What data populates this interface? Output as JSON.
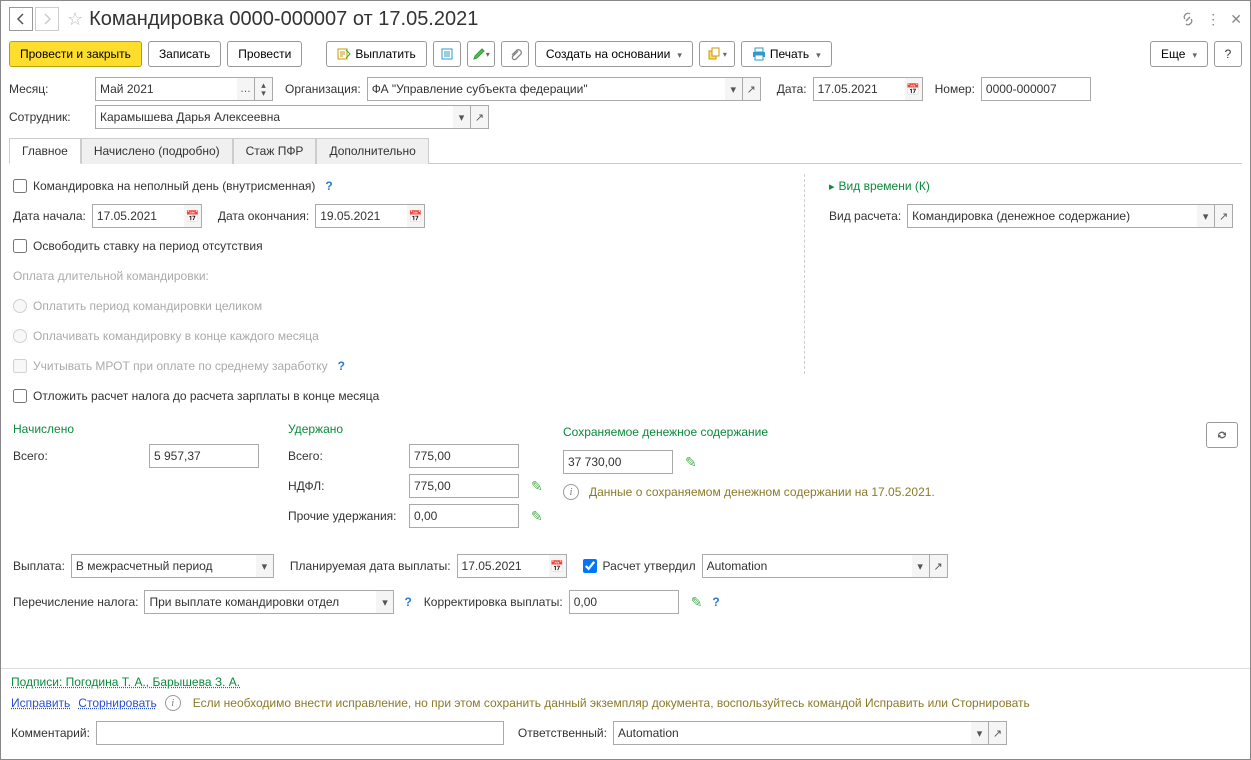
{
  "title": "Командировка 0000-000007 от 17.05.2021",
  "toolbar": {
    "post_close": "Провести и закрыть",
    "save": "Записать",
    "post": "Провести",
    "pay": "Выплатить",
    "create_based": "Создать на основании",
    "print": "Печать",
    "more": "Еще"
  },
  "header": {
    "month_label": "Месяц:",
    "month": "Май 2021",
    "org_label": "Организация:",
    "org": "ФА \"Управление субъекта федерации\"",
    "date_label": "Дата:",
    "date": "17.05.2021",
    "number_label": "Номер:",
    "number": "0000-000007",
    "employee_label": "Сотрудник:",
    "employee": "Карамышева Дарья Алексеевна"
  },
  "tabs": [
    "Главное",
    "Начислено (подробно)",
    "Стаж ПФР",
    "Дополнительно"
  ],
  "main": {
    "partial_day": "Командировка на неполный день (внутрисменная)",
    "start_label": "Дата начала:",
    "start": "17.05.2021",
    "end_label": "Дата окончания:",
    "end": "19.05.2021",
    "release_rate": "Освободить ставку на период отсутствия",
    "long_trip_label": "Оплата длительной командировки:",
    "pay_whole": "Оплатить период командировки целиком",
    "pay_monthly": "Оплачивать командировку в конце каждого месяца",
    "mrot": "Учитывать МРОТ при оплате по среднему заработку",
    "delay_tax": "Отложить расчет налога до расчета зарплаты в конце месяца",
    "time_kind": "Вид времени (К)",
    "calc_type_label": "Вид расчета:",
    "calc_type": "Командировка (денежное содержание)"
  },
  "amounts": {
    "accrued_head": "Начислено",
    "withheld_head": "Удержано",
    "kept_head": "Сохраняемое денежное содержание",
    "total_label": "Всего:",
    "accrued_total": "5 957,37",
    "withheld_total": "775,00",
    "ndfl_label": "НДФЛ:",
    "ndfl": "775,00",
    "other_label": "Прочие удержания:",
    "other": "0,00",
    "kept_value": "37 730,00",
    "kept_note": "Данные о сохраняемом денежном содержании на 17.05.2021."
  },
  "payment": {
    "pay_label": "Выплата:",
    "pay_mode": "В межрасчетный период",
    "planned_label": "Планируемая дата выплаты:",
    "planned_date": "17.05.2021",
    "approved_label": "Расчет утвердил",
    "approved_by": "Automation",
    "tax_transfer_label": "Перечисление налога:",
    "tax_transfer": "При выплате командировки отдел",
    "corr_label": "Корректировка выплаты:",
    "corr": "0,00"
  },
  "footer": {
    "signs": "Подписи: Погодина Т. А., Барышева З. А.",
    "fix": "Исправить",
    "storno": "Сторнировать",
    "info_text": "Если необходимо внести исправление, но при этом сохранить данный экземпляр документа, воспользуйтесь командой Исправить или Сторнировать",
    "comment_label": "Комментарий:",
    "resp_label": "Ответственный:",
    "resp": "Automation"
  }
}
